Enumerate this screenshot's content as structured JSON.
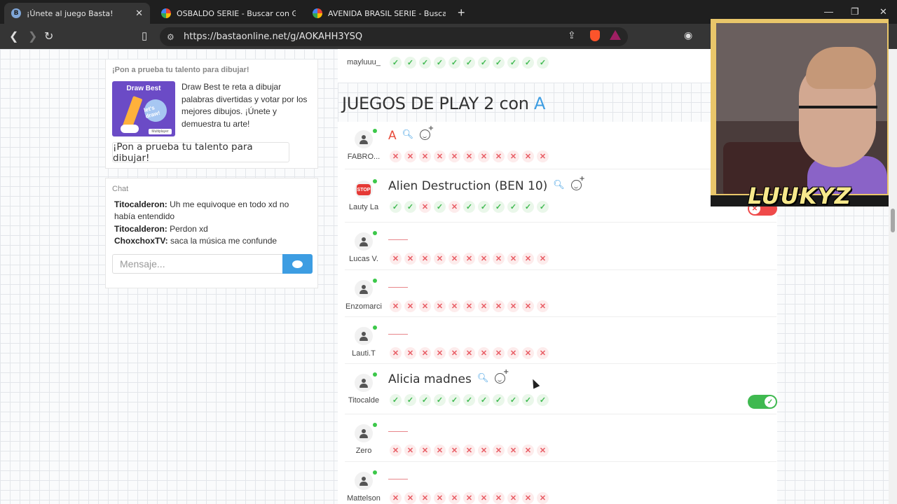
{
  "browser": {
    "tabs": [
      {
        "title": "¡Únete al juego Basta!",
        "active": true
      },
      {
        "title": "OSBALDO SERIE - Buscar con Google",
        "active": false
      },
      {
        "title": "AVENIDA BRASIL SERIE - Buscar con Google",
        "active": false
      }
    ],
    "url": "https://bastaonline.net/g/AOKAHH3YSQ"
  },
  "promo": {
    "heading": "¡Pon a prueba tu talento para dibujar!",
    "brand": "Draw Best",
    "bubble": "let's draw!",
    "tag": "Multiplayer",
    "text": "Draw Best te reta a dibujar palabras divertidas y votar por los mejores dibujos. ¡Únete y demuestra tu arte!",
    "button": "¡Pon a prueba tu talento para dibujar!"
  },
  "chat": {
    "heading": "Chat",
    "messages": [
      {
        "user": "Titocalderon:",
        "text": " Uh me equivoque en todo xd no había entendido"
      },
      {
        "user": "Titocalderon:",
        "text": " Perdon xd"
      },
      {
        "user": "ChoxchoxTV:",
        "text": " saca la música me confunde"
      }
    ],
    "placeholder": "Mensaje..."
  },
  "category": {
    "title": "JUEGOS DE PLAY 2 con ",
    "letter": "A"
  },
  "prev_player": {
    "name": "mayluuu_",
    "votes": [
      1,
      1,
      1,
      1,
      1,
      1,
      1,
      1,
      1,
      1,
      1
    ]
  },
  "players": [
    {
      "name": "FABRO...",
      "answer": "A",
      "answer_style": "red",
      "icons": true,
      "votes": [
        0,
        0,
        0,
        0,
        0,
        0,
        0,
        0,
        0,
        0,
        0
      ],
      "toggle": null
    },
    {
      "name": "Lauty La",
      "answer": "Alien Destruction (BEN 10)",
      "answer_style": "normal",
      "icons": true,
      "avatar": "stop",
      "votes": [
        1,
        1,
        0,
        1,
        0,
        1,
        1,
        1,
        1,
        1,
        1
      ],
      "toggle": "off"
    },
    {
      "name": "Lucas V.",
      "answer": "",
      "votes": [
        0,
        0,
        0,
        0,
        0,
        0,
        0,
        0,
        0,
        0,
        0
      ],
      "toggle": null
    },
    {
      "name": "Enzomarci",
      "answer": "",
      "votes": [
        0,
        0,
        0,
        0,
        0,
        0,
        0,
        0,
        0,
        0,
        0
      ],
      "toggle": null
    },
    {
      "name": "Lauti.T",
      "answer": "",
      "votes": [
        0,
        0,
        0,
        0,
        0,
        0,
        0,
        0,
        0,
        0,
        0
      ],
      "toggle": null
    },
    {
      "name": "Titocalde",
      "answer": "Alicia madnes",
      "answer_style": "normal",
      "icons": true,
      "votes": [
        1,
        1,
        1,
        1,
        1,
        1,
        1,
        1,
        1,
        1,
        1
      ],
      "toggle": "on"
    },
    {
      "name": "Zero",
      "answer": "",
      "votes": [
        0,
        0,
        0,
        0,
        0,
        0,
        0,
        0,
        0,
        0,
        0
      ],
      "toggle": null
    },
    {
      "name": "Mattelson",
      "answer": "",
      "votes": [
        0,
        0,
        0,
        0,
        0,
        0,
        0,
        0,
        0,
        0,
        0
      ],
      "toggle": null
    }
  ],
  "webcam": {
    "name": "LUUKYZ"
  }
}
